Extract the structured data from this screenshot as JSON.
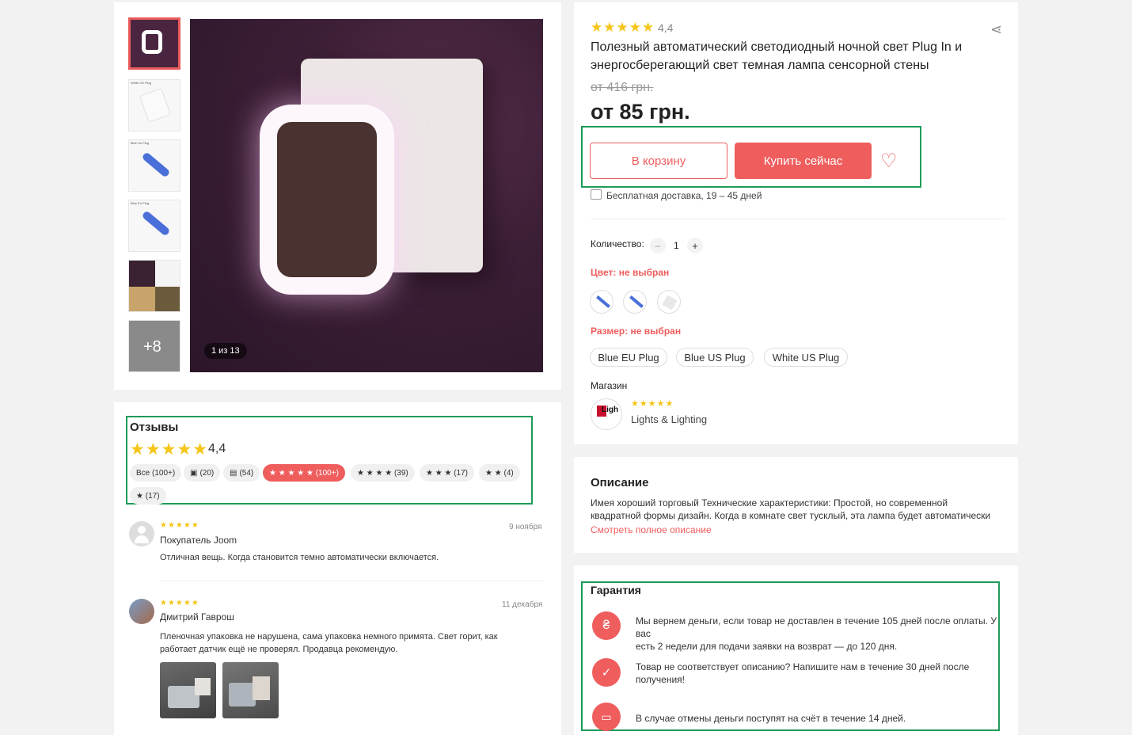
{
  "gallery": {
    "thumb_labels": [
      "",
      "White US Plug",
      "Blue Us Plug",
      "Blue Eu Plug",
      "",
      ""
    ],
    "more_label": "+8",
    "counter": "1 из 13"
  },
  "product": {
    "rating": "4,4",
    "title_line1": "Полезный автоматический светодиодный ночной свет Plug In и",
    "title_line2": "энергосберегающий свет темная лампа сенсорной стены",
    "old_price": "от 416 грн.",
    "price": "от 85 грн.",
    "cart_label": "В корзину",
    "buy_label": "Купить сейчас",
    "delivery": "Бесплатная доставка, 19 – 45 дней",
    "quantity_label": "Количество:",
    "quantity_value": "1",
    "minus": "–",
    "plus": "+",
    "color_label": "Цвет: не выбран",
    "size_label": "Размер: не выбран",
    "sizes": [
      "Blue EU Plug",
      "Blue US Plug",
      "White US Plug"
    ],
    "store_label": "Магазин",
    "store_name": "Lights & Lighting",
    "store_logo_text": "Ligh",
    "accent_color": "#ef5d5d"
  },
  "description": {
    "title": "Описание",
    "line1": "Имея хороший торговый Технические характеристики: Простой, но современной",
    "line2": "квадратной формы дизайн. Когда в комнате свет тусклый, эта лампа будет автоматически",
    "more": "Смотреть полное описание"
  },
  "guarantee": {
    "title": "Гарантия",
    "item1_line1": "Мы вернем деньги, если товар не доставлен в течение 105 дней после оплаты. У вас",
    "item1_line2": "есть 2 недели для подачи заявки на возврат — до 120 дня.",
    "item2_line1": "Товар не соответствует описанию? Напишите нам в течение 30 дней после",
    "item2_line2": "получения!",
    "item3": "В случае отмены деньги поступят на счёт в течение 14 дней."
  },
  "reviews": {
    "title": "Отзывы",
    "rating": "4,4",
    "filters": [
      "Все (100+)",
      "(20)",
      "(54)",
      "★ ★ ★ ★ ★ (100+)",
      "★ ★ ★ ★ (39)",
      "★ ★ ★ (17)",
      "★ ★ (4)",
      "★ (17)"
    ],
    "items": [
      {
        "author": "Покупатель Joom",
        "date": "9 ноября",
        "text": "Отличная вещь. Когда становится темно автоматически включается."
      },
      {
        "author": "Дмитрий Гаврош",
        "date": "11 декабря",
        "text1": "Пленочная упаковка не нарушена, сама упаковка немного примята. Свет горит, как",
        "text2": "работает датчик ещё не проверял. Продавца рекомендую."
      }
    ]
  }
}
